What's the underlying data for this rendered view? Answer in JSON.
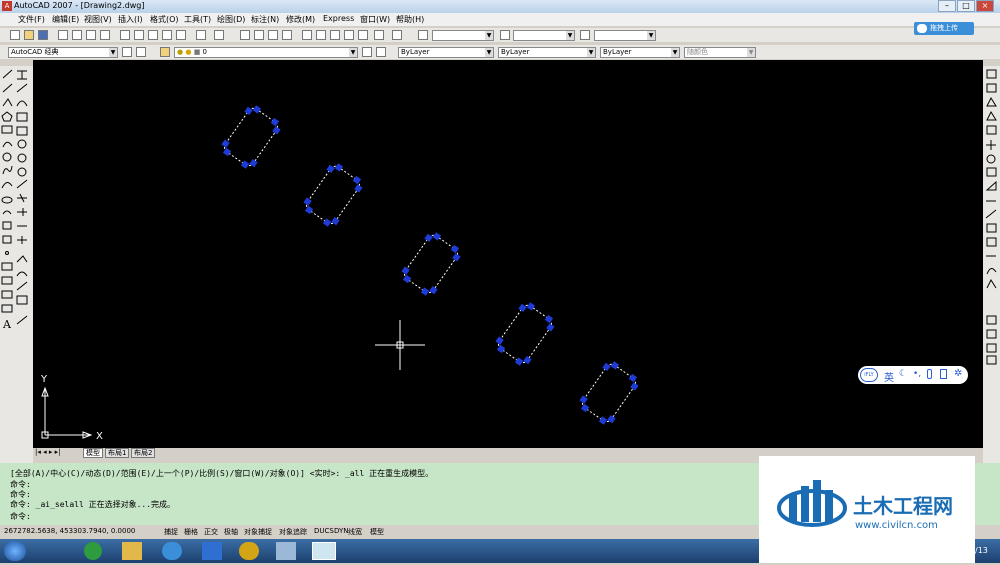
{
  "app": {
    "title": "AutoCAD 2007 - [Drawing2.dwg]",
    "icon_letter": "A"
  },
  "window_buttons": [
    "–",
    "□",
    "×"
  ],
  "menu": [
    "文件(F)",
    "编辑(E)",
    "视图(V)",
    "插入(I)",
    "格式(O)",
    "工具(T)",
    "绘图(D)",
    "标注(N)",
    "修改(M)",
    "Express",
    "窗口(W)",
    "帮助(H)"
  ],
  "toolbar": {
    "workspace": "AutoCAD 经典",
    "layer": "0",
    "color": "ByLayer",
    "linetype": "ByLayer",
    "lineweight": "ByLayer",
    "plotstyle": "随颜色"
  },
  "upload_button": "拖拽上传",
  "tabs": [
    "模型",
    "布局1",
    "布局2"
  ],
  "ucs": {
    "x_label": "X",
    "y_label": "Y"
  },
  "ime": {
    "lang": "英",
    "logo": "iFLY"
  },
  "command_lines": [
    "[全部(A)/中心(C)/动态(D)/范围(E)/上一个(P)/比例(S)/窗口(W)/对象(O)] <实时>: _all 正在重生成模型。",
    "命令:",
    "命令:",
    "命令: _ai_selall 正在选择对象...完成。",
    "命令:"
  ],
  "status": {
    "coords": "2672782.5638,  453303.7940, 0.0000",
    "toggles": [
      "捕捉",
      "栅格",
      "正交",
      "极轴",
      "对象捕捉",
      "对象追踪",
      "DUCS",
      "DYN",
      "线宽",
      "模型"
    ]
  },
  "watermark": {
    "title": "土木工程网",
    "url": "www.civilcn.com"
  },
  "taskbar_clock": "/13",
  "colors": {
    "canvas": "#000000",
    "grip": "#1f3bd6",
    "command_bg": "#c7e6c7",
    "watermark_blue": "#1a6db5"
  }
}
